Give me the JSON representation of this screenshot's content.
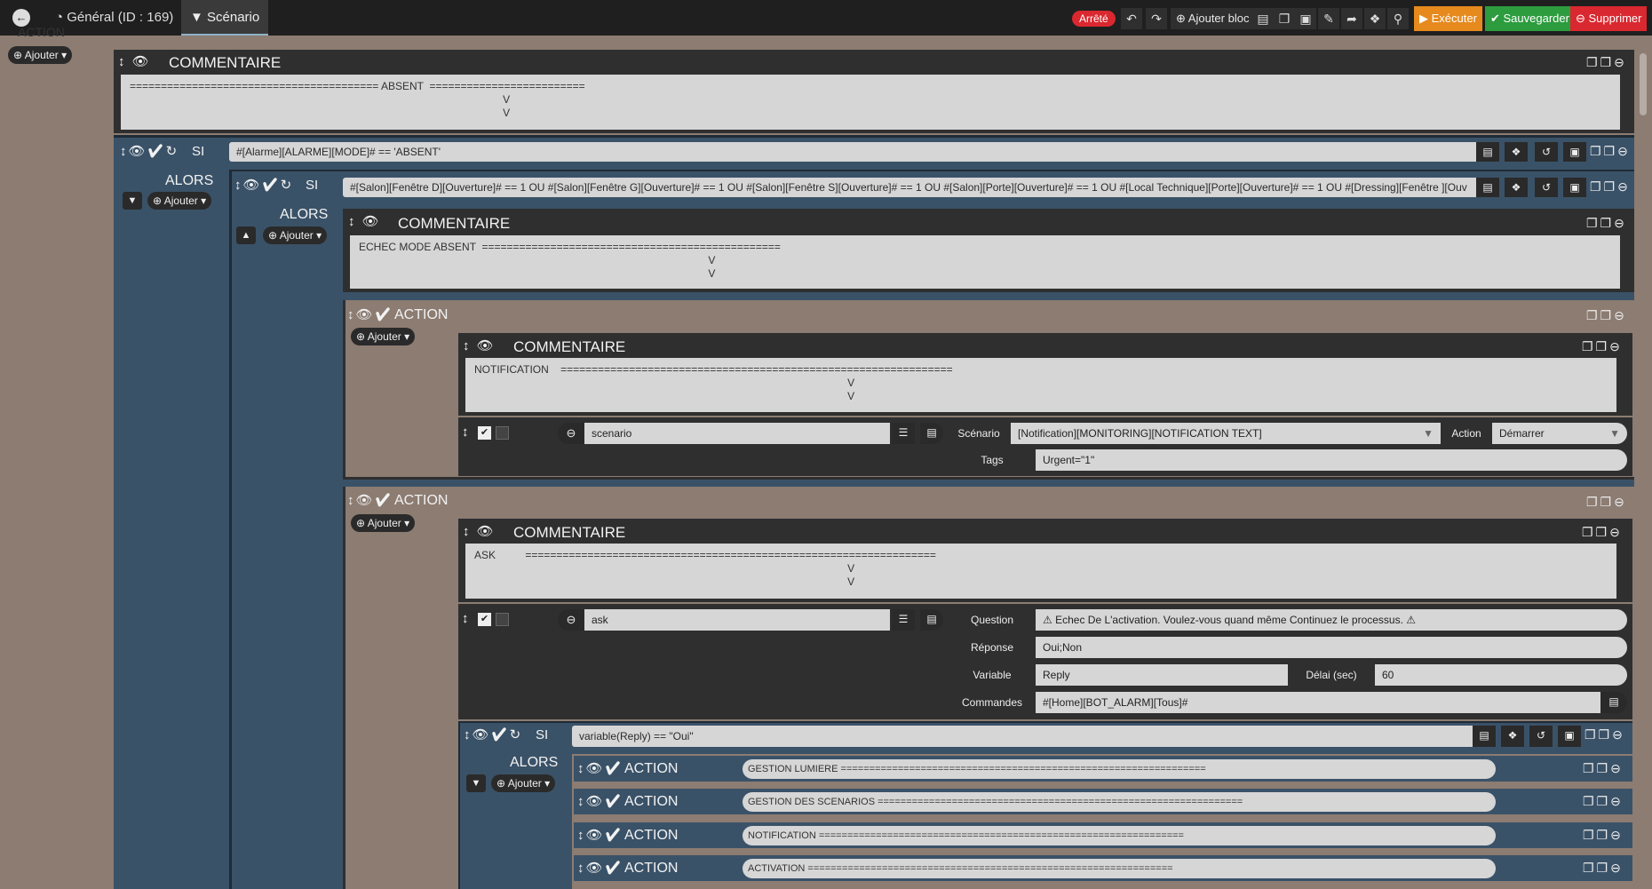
{
  "topbar": {
    "back_icon": "arrow-left-icon",
    "tab_general": "Général (ID : 169)",
    "tab_scenario": "Scénario",
    "status_badge": "Arrêté",
    "add_block": "Ajouter bloc",
    "execute": "Exécuter",
    "save": "Sauvegarder",
    "delete": "Supprimer"
  },
  "labels": {
    "ajouter": "Ajouter",
    "commentaire": "COMMENTAIRE",
    "si": "SI",
    "alors": "ALORS",
    "action": "ACTION"
  },
  "top_partial_label": "ACTION",
  "comment_absent": "======================================== ABSENT  =========================\n                                                                                                                              V\n                                                                                                                              V",
  "si_outer_condition": "#[Alarme][ALARME][MODE]# == 'ABSENT'",
  "si_inner_condition": "#[Salon][Fenêtre D][Ouverture]# == 1  OU #[Salon][Fenêtre G][Ouverture]# == 1  OU #[Salon][Fenêtre S][Ouverture]# == 1  OU #[Salon][Porte][Ouverture]# == 1  OU #[Local Technique][Porte][Ouverture]# == 1  OU #[Dressing][Fenêtre ][Ouv",
  "comment_echec": "ECHEC MODE ABSENT  ================================================\n                                                                                                                      V\n                                                                                                                      V",
  "comment_notification": "NOTIFICATION    ===============================================================\n                                                                                                                              V\n                                                                                                                              V",
  "scenario_action": {
    "name": "scenario",
    "scenario_label": "Scénario",
    "scenario_value": "[Notification][MONITORING][NOTIFICATION TEXT]",
    "action_label": "Action",
    "action_value": "Démarrer",
    "tags_label": "Tags",
    "tags_value": "Urgent=\"1\""
  },
  "comment_ask": "ASK          ==================================================================\n                                                                                                                              V\n                                                                                                                              V",
  "ask_action": {
    "name": "ask",
    "question_label": "Question",
    "question_value": "⚠ Echec De L'activation. Voulez-vous quand même Continuez le processus. ⚠",
    "reponse_label": "Réponse",
    "reponse_value": "Oui;Non",
    "variable_label": "Variable",
    "variable_value": "Reply",
    "delai_label": "Délai (sec)",
    "delai_value": "60",
    "commandes_label": "Commandes",
    "commandes_value": "#[Home][BOT_ALARM][Tous]#"
  },
  "si_reply_condition": "variable(Reply) == \"Oui\"",
  "sub_actions": [
    {
      "label": "ACTION",
      "comment": "GESTION LUMIERE ================================================================"
    },
    {
      "label": "ACTION",
      "comment": "GESTION DES SCENARIOS ================================================================"
    },
    {
      "label": "ACTION",
      "comment": "NOTIFICATION ================================================================"
    },
    {
      "label": "ACTION",
      "comment": "ACTIVATION ================================================================"
    }
  ]
}
